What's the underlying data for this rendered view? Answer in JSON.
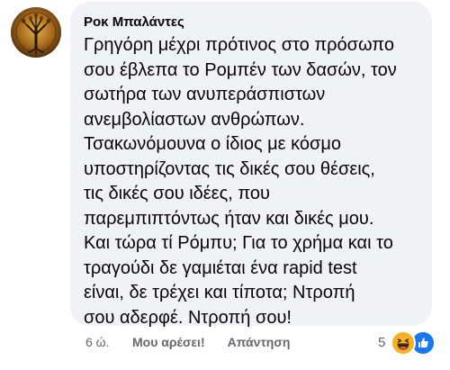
{
  "comment": {
    "author": "Ροκ Μπαλάντες",
    "lines": [
      "Γρηγόρη μέχρι πρότινος στο πρόσωπο",
      "σου έβλεπα το Ρομπέν των δασών, τον",
      "σωτήρα των ανυπεράσπιστων",
      "ανεμβολίαστων ανθρώπων.",
      "Τσακωνόμουνα ο ίδιος με κόσμο",
      "υποστηρίζοντας τις δικές σου θέσεις,",
      "τις δικές σου ιδέες, που",
      "παρεμπιπτόντως ήταν και δικές μου.",
      "Και τώρα τί Ρόμπυ; Για το χρήμα και το",
      "τραγούδι δε γαμιέται ένα rapid test",
      "είναι, δε τρέχει και τίποτα; Ντροπή",
      "σου αδερφέ. Ντροπή σου!"
    ],
    "time": "6 ώ.",
    "like_label": "Μου αρέσει!",
    "reply_label": "Απάντηση",
    "reaction_count": "5",
    "reaction_icons": [
      "haha-icon",
      "like-icon"
    ]
  },
  "colors": {
    "bubble": "#f0f2f5",
    "text": "#050505",
    "meta": "#65676b",
    "like_blue": "#1877f2",
    "haha_yellow": "#f7b125"
  }
}
